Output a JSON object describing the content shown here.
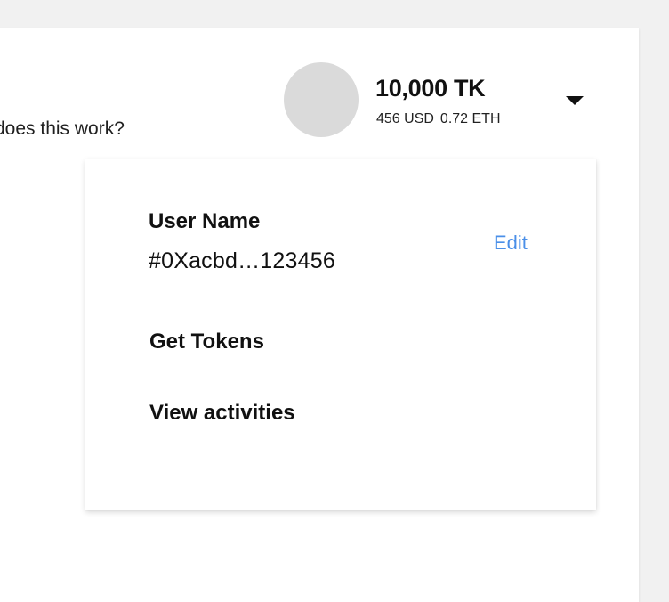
{
  "header": {
    "help_link": "does this work?",
    "balance": "10,000 TK",
    "usd": "456 USD",
    "eth": "0.72 ETH",
    "caret_icon": "caret-down-icon"
  },
  "dropdown": {
    "user_name": "User Name",
    "address": "#0Xacbd…123456",
    "edit": "Edit",
    "items": [
      {
        "label": "Get Tokens"
      },
      {
        "label": "View activities"
      }
    ]
  },
  "colors": {
    "background": "#f1f1f1",
    "panel": "#ffffff",
    "avatar": "#dadada",
    "accent": "#4a8fe8",
    "text": "#111111"
  }
}
